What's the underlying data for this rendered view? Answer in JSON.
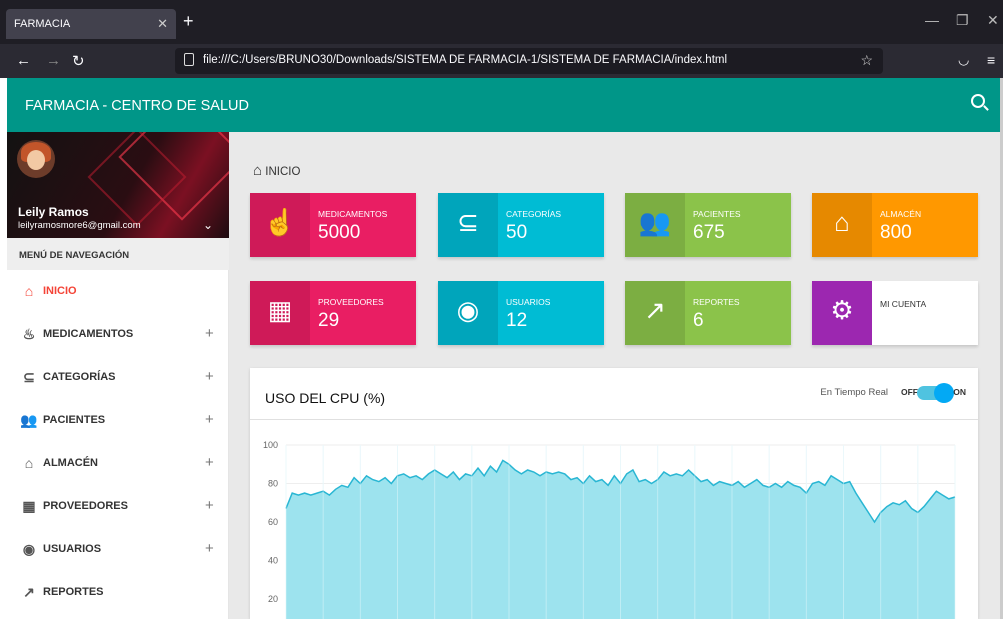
{
  "browser": {
    "tab_title": "FARMACIA",
    "url": "file:///C:/Users/BRUNO30/Downloads/SISTEMA DE FARMACIA-1/SISTEMA DE FARMACIA/index.html"
  },
  "header": {
    "title": "FARMACIA - CENTRO DE SALUD"
  },
  "user": {
    "name": "Leily Ramos",
    "email": "leilyramosmore6@gmail.com"
  },
  "sidebar": {
    "heading": "MENÚ DE NAVEGACIÓN",
    "items": [
      {
        "label": "INICIO",
        "icon": "home-icon"
      },
      {
        "label": "MEDICAMENTOS",
        "icon": "medicine-hand-icon"
      },
      {
        "label": "CATEGORÍAS",
        "icon": "category-icon"
      },
      {
        "label": "PACIENTES",
        "icon": "people-icon"
      },
      {
        "label": "ALMACÉN",
        "icon": "warehouse-icon"
      },
      {
        "label": "PROVEEDORES",
        "icon": "building-icon"
      },
      {
        "label": "USUARIOS",
        "icon": "user-circle-icon"
      },
      {
        "label": "REPORTES",
        "icon": "trending-up-icon"
      }
    ]
  },
  "breadcrumb": "INICIO",
  "cards": [
    {
      "label": "MEDICAMENTOS",
      "value": "5000",
      "color": "#e91e63",
      "dark": "#cf1a58"
    },
    {
      "label": "CATEGORÍAS",
      "value": "50",
      "color": "#00bcd4",
      "dark": "#00a5bb"
    },
    {
      "label": "PACIENTES",
      "value": "675",
      "color": "#8bc34a",
      "dark": "#7cae42"
    },
    {
      "label": "ALMACÉN",
      "value": "800",
      "color": "#ff9800",
      "dark": "#e68900"
    },
    {
      "label": "PROVEEDORES",
      "value": "29",
      "color": "#e91e63",
      "dark": "#cf1a58"
    },
    {
      "label": "USUARIOS",
      "value": "12",
      "color": "#00bcd4",
      "dark": "#00a5bb"
    },
    {
      "label": "REPORTES",
      "value": "6",
      "color": "#8bc34a",
      "dark": "#7cae42"
    },
    {
      "label": "MI CUENTA",
      "value": "",
      "color": "#9c27b0",
      "dark": "#9c27b0"
    }
  ],
  "cpu_panel": {
    "title": "USO DEL CPU (%)",
    "realtime_label": "En Tiempo Real",
    "off_label": "OFF",
    "on_label": "ON"
  },
  "chart_data": {
    "type": "area",
    "title": "USO DEL CPU (%)",
    "y_ticks": [
      100,
      80,
      60,
      40,
      20
    ],
    "ylim": [
      0,
      100
    ],
    "grid": true,
    "fill_color": "#9de3ee",
    "line_color": "#29b6d3",
    "values": [
      67,
      75,
      74,
      75,
      74,
      75,
      76,
      74,
      77,
      79,
      78,
      83,
      80,
      84,
      82,
      81,
      83,
      80,
      84,
      85,
      83,
      84,
      82,
      85,
      87,
      85,
      83,
      86,
      82,
      85,
      84,
      88,
      84,
      89,
      86,
      92,
      90,
      87,
      85,
      87,
      86,
      84,
      86,
      85,
      86,
      85,
      82,
      83,
      80,
      84,
      81,
      82,
      79,
      84,
      80,
      85,
      87,
      81,
      82,
      80,
      82,
      86,
      84,
      85,
      84,
      87,
      84,
      81,
      82,
      79,
      81,
      80,
      79,
      81,
      78,
      80,
      82,
      79,
      78,
      80,
      78,
      81,
      79,
      78,
      75,
      80,
      81,
      79,
      84,
      82,
      80,
      81,
      75,
      70,
      65,
      60,
      65,
      68,
      70,
      69,
      71,
      67,
      65,
      68,
      72,
      76,
      74,
      72,
      73
    ]
  }
}
